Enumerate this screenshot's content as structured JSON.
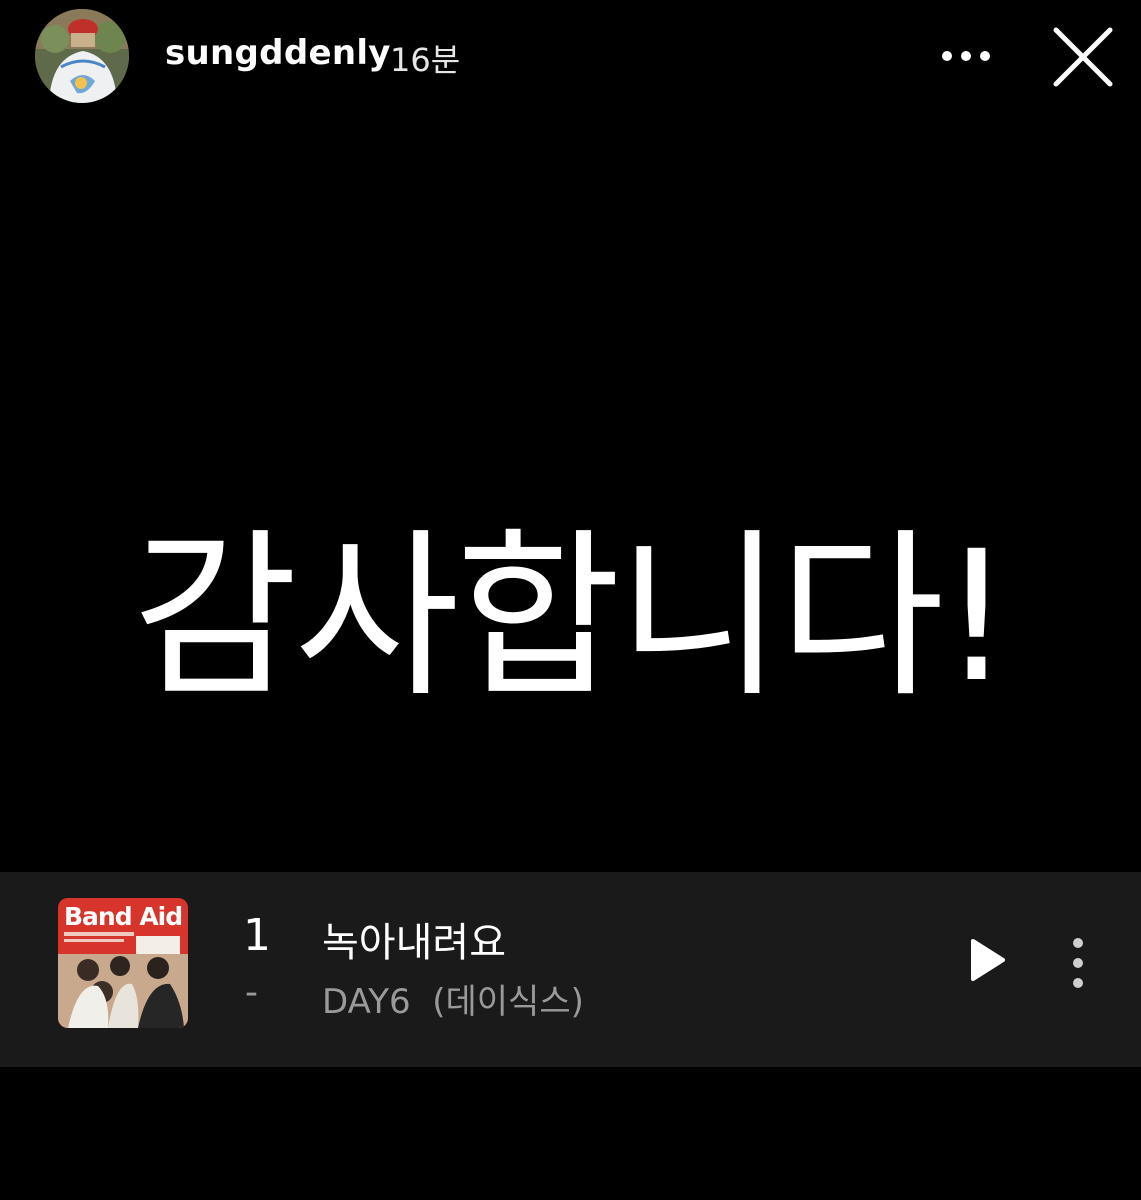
{
  "header": {
    "username": "sungddenly",
    "timestamp": "16분",
    "avatar_icon": "profile-avatar",
    "more_icon": "more-horizontal-icon",
    "close_icon": "close-icon"
  },
  "story": {
    "text": "감사합니다!"
  },
  "music": {
    "album_label": "Band Aid",
    "track_number": "1",
    "dash": "-",
    "title": "녹아내려요",
    "artist": "DAY6  (데이식스)",
    "play_icon": "play-icon",
    "options_icon": "more-vertical-icon"
  },
  "colors": {
    "background": "#000000",
    "music_bar": "#1a1a1a",
    "album_red": "#d7342b",
    "secondary_text": "#9a9a9a"
  }
}
